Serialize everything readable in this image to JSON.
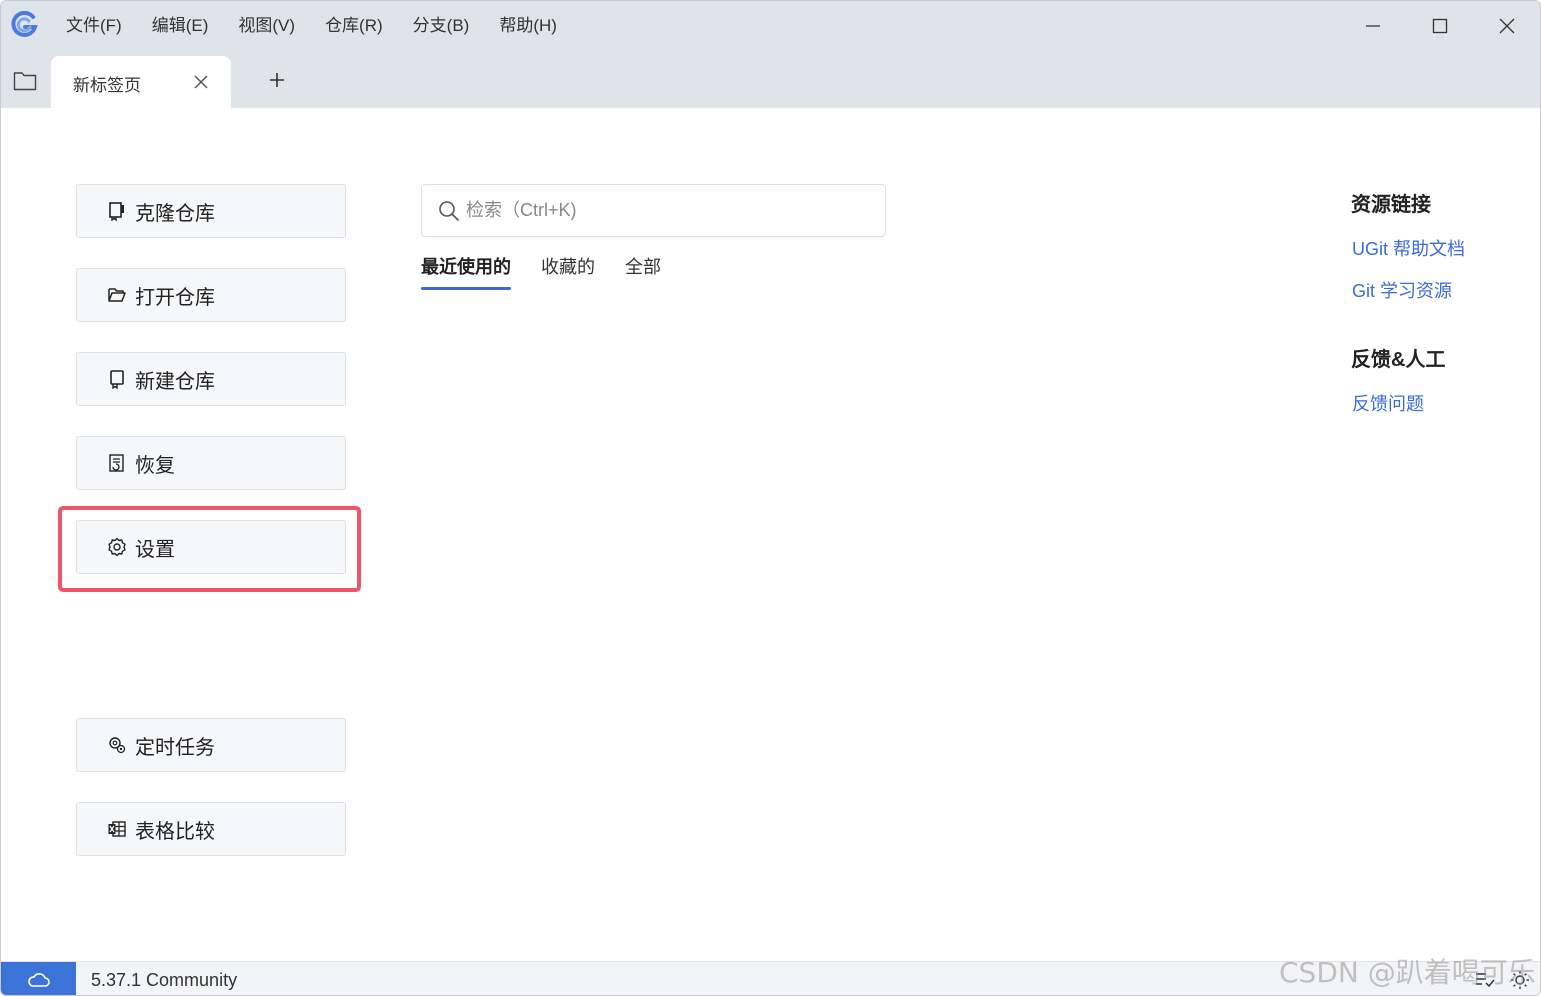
{
  "menu": [
    "文件(F)",
    "编辑(E)",
    "视图(V)",
    "仓库(R)",
    "分支(B)",
    "帮助(H)"
  ],
  "tab": {
    "label": "新标签页"
  },
  "actions": {
    "clone": "克隆仓库",
    "open": "打开仓库",
    "create": "新建仓库",
    "restore": "恢复",
    "settings": "设置",
    "scheduled": "定时任务",
    "compare": "表格比较"
  },
  "search": {
    "placeholder": "检索（Ctrl+K)"
  },
  "filter_tabs": [
    "最近使用的",
    "收藏的",
    "全部"
  ],
  "resources": {
    "heading": "资源链接",
    "links": [
      "UGit 帮助文档",
      "Git 学习资源"
    ]
  },
  "feedback": {
    "heading": "反馈&人工",
    "links": [
      "反馈问题"
    ]
  },
  "status": {
    "version": "5.37.1 Community"
  },
  "watermark": "CSDN @趴着喝可乐",
  "colors": {
    "accent": "#3a68d8",
    "highlight": "#f0546a",
    "titlebar": "#dfe3ea"
  }
}
